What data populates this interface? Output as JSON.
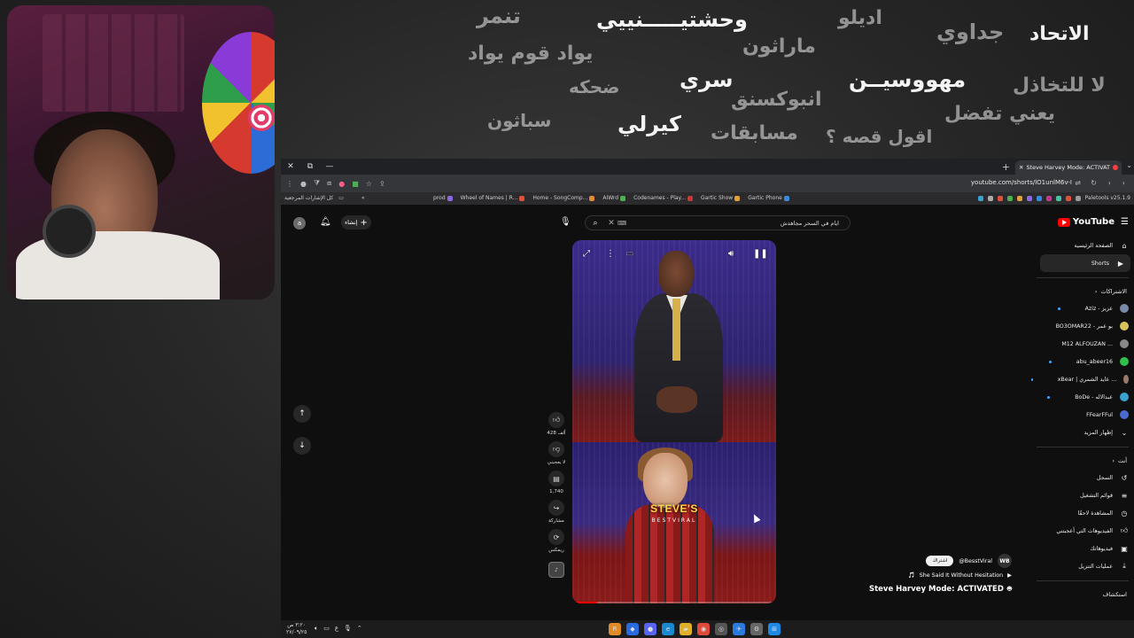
{
  "chalkboard": {
    "words": [
      {
        "text": "تنمر",
        "bright": false
      },
      {
        "text": "وحشتيـــــنييي",
        "bright": true
      },
      {
        "text": "اديلو",
        "bright": false
      },
      {
        "text": "جداوي",
        "bright": false
      },
      {
        "text": "الاتحاد",
        "bright": true
      },
      {
        "text": "يواد قوم يواد",
        "bright": false
      },
      {
        "text": "ماراثون",
        "bright": false
      },
      {
        "text": "سري",
        "bright": true
      },
      {
        "text": "مهووسيــن",
        "bright": true
      },
      {
        "text": "لا للتخاذل",
        "bright": false
      },
      {
        "text": "ضحكه",
        "bright": false
      },
      {
        "text": "انبوكسنق",
        "bright": false
      },
      {
        "text": "يعني تفضل",
        "bright": false
      },
      {
        "text": "سباثون",
        "bright": false
      },
      {
        "text": "كيرلي",
        "bright": true
      },
      {
        "text": "مسابقات",
        "bright": false
      },
      {
        "text": "اقول قصه ؟",
        "bright": false
      }
    ]
  },
  "browser": {
    "tab_title": "Steve Harvey Mode: ACTIVAT",
    "url": "youtube.com/shorts/lO1unlM6v-I",
    "extension_label": "Paletools v25.1.9",
    "bookmarks_all": "كل الإشارات المرجعية",
    "bookmarks": [
      "prod",
      "Wheel of Names | R...",
      "Home - SongComp...",
      "AIWrd",
      "Codenames - Play...",
      "Gartic Show",
      "Gartic Phone"
    ]
  },
  "youtube": {
    "logo_text": "YouTube",
    "avatar_letter": "a",
    "create_label": "إنشاء",
    "search_value": "ايام في السحر مجاهدش",
    "sidebar": {
      "home": "الصفحة الرئيسية",
      "shorts": "Shorts",
      "subs_header": "الاشتراكات",
      "subscriptions": [
        {
          "name": "Aziz - عزيز",
          "color": "#7a8aa8"
        },
        {
          "name": "BO3OMAR22 - بو عمر",
          "color": "#d9c25a"
        },
        {
          "name": "M12 ALFOUZAN ...",
          "color": "#888888"
        },
        {
          "name": "abu_abeer16",
          "color": "#2fbf4a"
        },
        {
          "name": "xBear | عايد الشمري ...",
          "color": "#9a7a6a"
        },
        {
          "name": "BoDe - عبدالاله",
          "color": "#3aa0d0"
        },
        {
          "name": "FFearFFul",
          "color": "#4a6ad0"
        }
      ],
      "show_more": "إظهار المزيد",
      "you_header": "أنت",
      "you_items": [
        "السجل",
        "قوائم التشغيل",
        "المشاهدة لاحقًا",
        "الفيديوهات التي أعجبتني",
        "فيديوهاتك",
        "عمليات التنزيل"
      ],
      "explore_header": "استكشاف"
    },
    "short": {
      "watermark": "STEVE'S",
      "watermark_sub": "BESTVIRAL",
      "progress": 0.12
    },
    "actions": {
      "likes": "428 ألف",
      "dislike": "لا يعجبني",
      "comments": "1,740",
      "share": "مشاركة",
      "remix": "ريمكس"
    },
    "info": {
      "channel": "@BesstViral",
      "subscribe": "اشتراك",
      "channel_logo": "WB",
      "sound": "She Said It Without Hesitation",
      "title": "Steve Harvey Mode: ACTIVATED"
    }
  },
  "taskbar": {
    "time": "٣:٢٠ ص",
    "date": "٢٧/٠٩/٢٥",
    "lang": "ع"
  }
}
